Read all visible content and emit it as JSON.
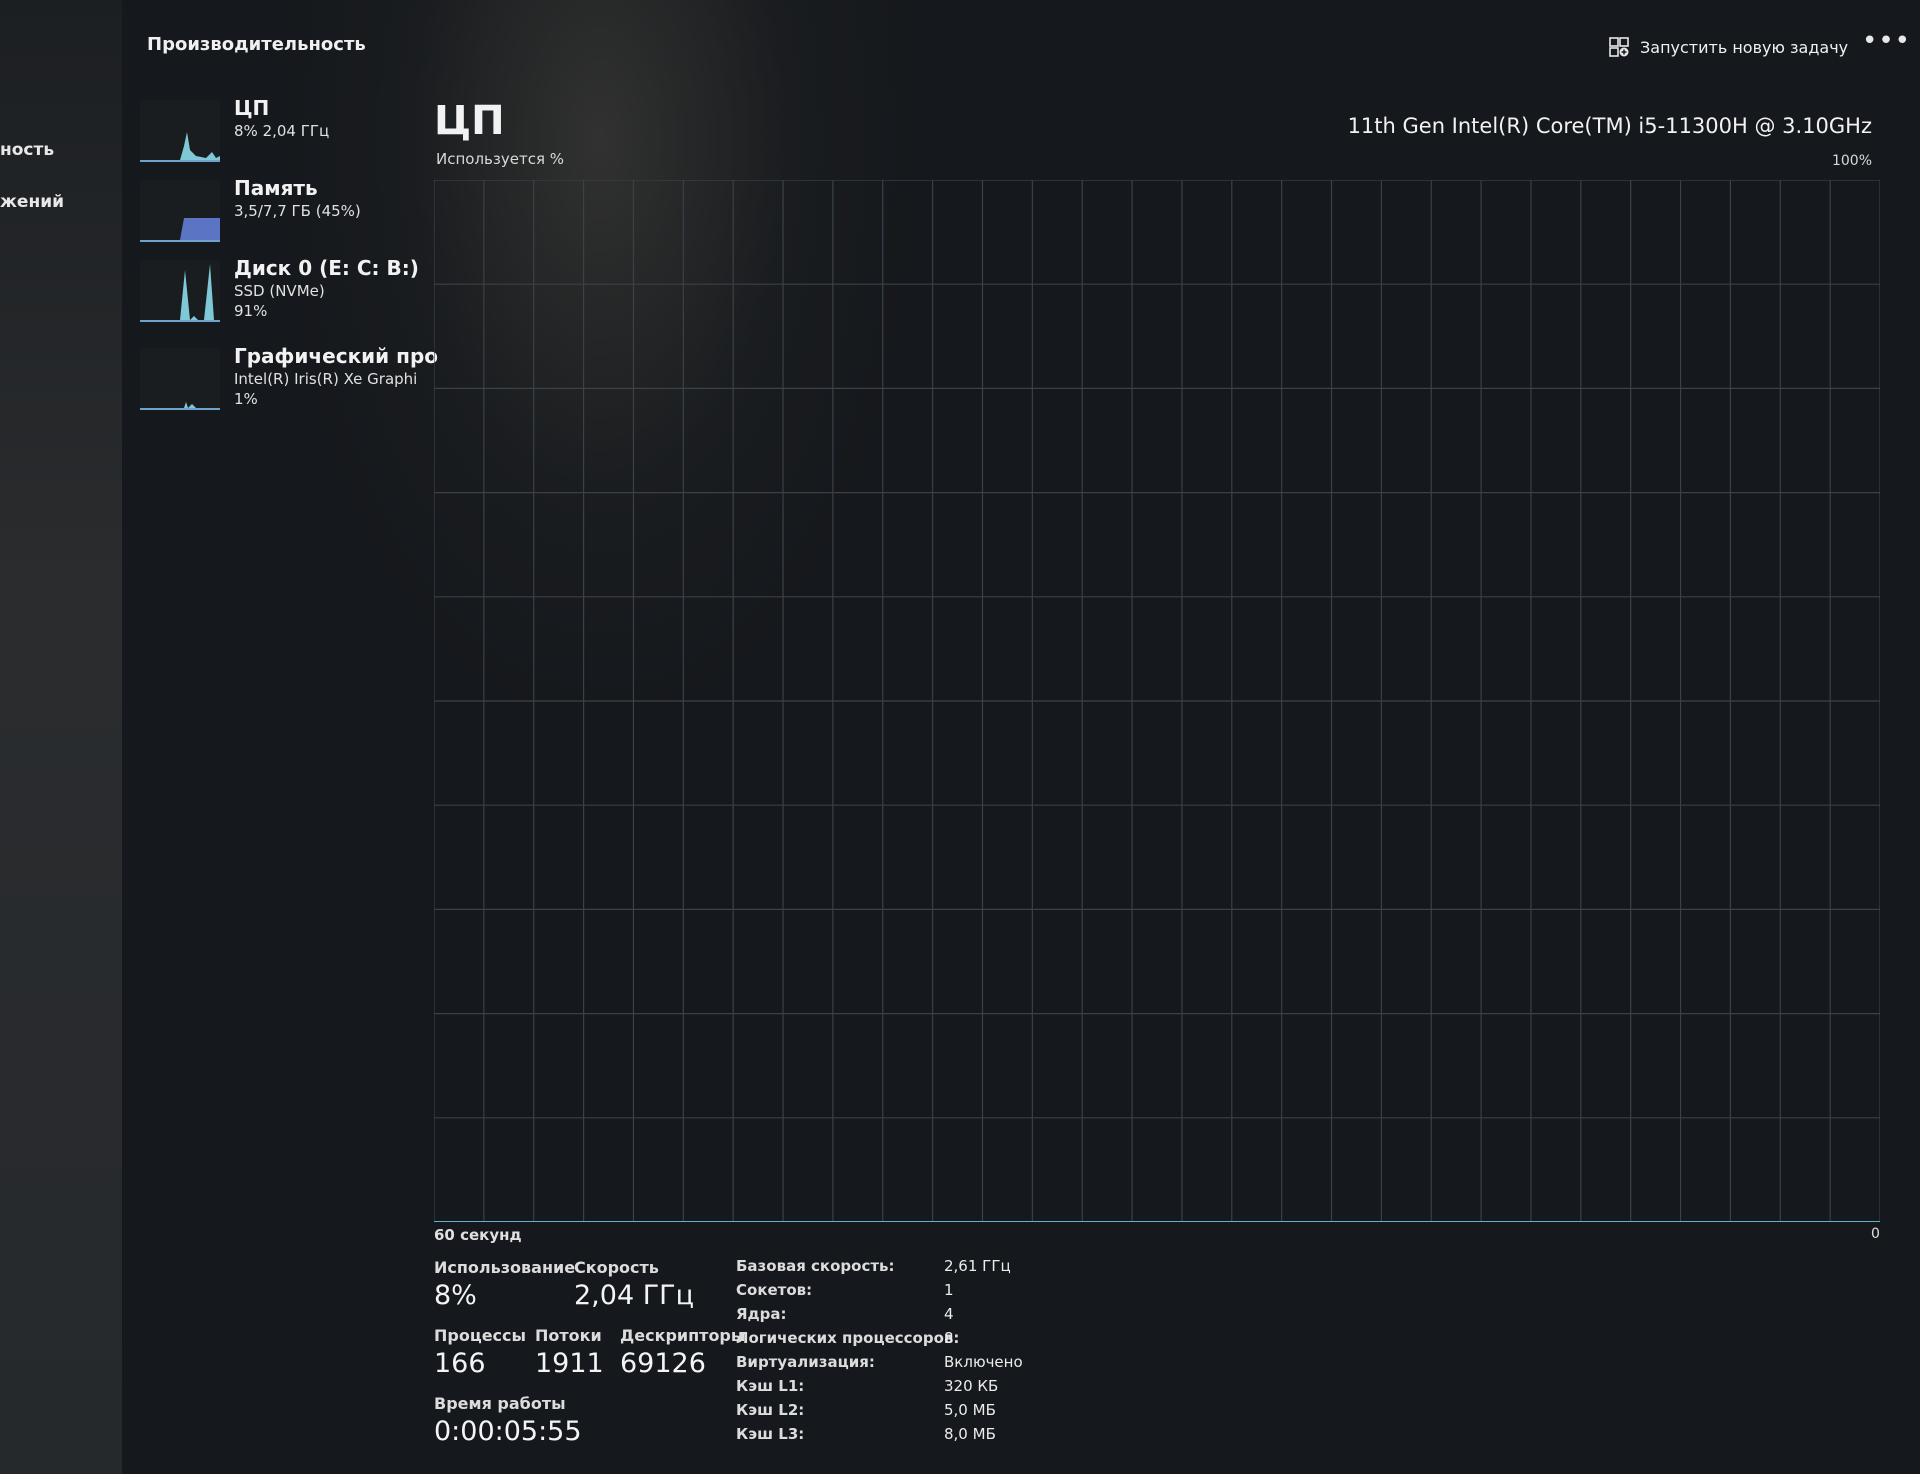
{
  "header": {
    "title": "Производительность",
    "run_task_label": "Запустить новую задачу",
    "more_label": "•••"
  },
  "nav": {
    "items": [
      "ность",
      "жений"
    ]
  },
  "sidebar": {
    "items": [
      {
        "name": "ЦП",
        "line1": "8% 2,04 ГГц",
        "line2": ""
      },
      {
        "name": "Память",
        "line1": "3,5/7,7 ГБ (45%)",
        "line2": ""
      },
      {
        "name": "Диск 0 (E: C: B:)",
        "line1": "SSD (NVMe)",
        "line2": "91%"
      },
      {
        "name": "Графический про",
        "line1": "Intel(R) Iris(R) Xe Graphi",
        "line2": "1%"
      }
    ]
  },
  "main": {
    "title": "ЦП",
    "subtitle": "Используется %",
    "processor": "11th Gen Intel(R) Core(TM) i5-11300H @ 3.10GHz",
    "max_label": "100%",
    "time_label": "60 секунд",
    "zero_label": "0"
  },
  "stats": {
    "usage_label": "Использование",
    "usage_value": "8%",
    "speed_label": "Скорость",
    "speed_value": "2,04 ГГц",
    "processes_label": "Процессы",
    "processes_value": "166",
    "threads_label": "Потоки",
    "threads_value": "1911",
    "handles_label": "Дескрипторы",
    "handles_value": "69126",
    "uptime_label": "Время работы",
    "uptime_value": "0:00:05:55"
  },
  "specs": [
    {
      "label": "Базовая скорость:",
      "value": "2,61 ГГц"
    },
    {
      "label": "Сокетов:",
      "value": "1"
    },
    {
      "label": "Ядра:",
      "value": "4"
    },
    {
      "label": "Логических процессоров:",
      "value": "8"
    },
    {
      "label": "Виртуализация:",
      "value": "Включено"
    },
    {
      "label": "Кэш L1:",
      "value": "320 КБ"
    },
    {
      "label": "Кэш L2:",
      "value": "5,0 МБ"
    },
    {
      "label": "Кэш L3:",
      "value": "8,0 МБ"
    }
  ],
  "colors": {
    "graph_fill": "#7fc8d8",
    "graph_line": "#5fb4c8",
    "grid": "#3a4148",
    "memory_fill": "#5b74c4"
  },
  "chart_data": {
    "type": "area",
    "x": [
      60,
      59,
      58,
      57,
      56,
      55,
      54,
      53,
      52,
      51,
      50,
      49,
      48,
      47,
      46,
      45,
      44,
      43,
      42,
      41,
      40,
      39,
      38,
      37,
      36,
      35,
      34,
      33,
      32,
      31,
      30,
      29,
      28,
      27,
      26,
      25,
      24,
      23,
      22,
      21,
      20,
      19,
      18,
      17,
      16,
      15,
      14,
      13,
      12,
      11,
      10,
      9,
      8,
      7,
      6,
      5,
      4,
      3,
      2,
      1,
      0
    ],
    "values": [
      0,
      0,
      0,
      0,
      0,
      0,
      0,
      0,
      0,
      0,
      0,
      0,
      0,
      0,
      0,
      0,
      0,
      0,
      0,
      0,
      0,
      0,
      0,
      0,
      0,
      0,
      0,
      0,
      0,
      0,
      0,
      0,
      0,
      0,
      0,
      0,
      0,
      0,
      0,
      0,
      0,
      0,
      0,
      0,
      0,
      0,
      0,
      0,
      0,
      0,
      0,
      0,
      0,
      0,
      0,
      0,
      0,
      0,
      0,
      0,
      0
    ],
    "ylim": [
      0,
      100
    ],
    "grid": true
  }
}
